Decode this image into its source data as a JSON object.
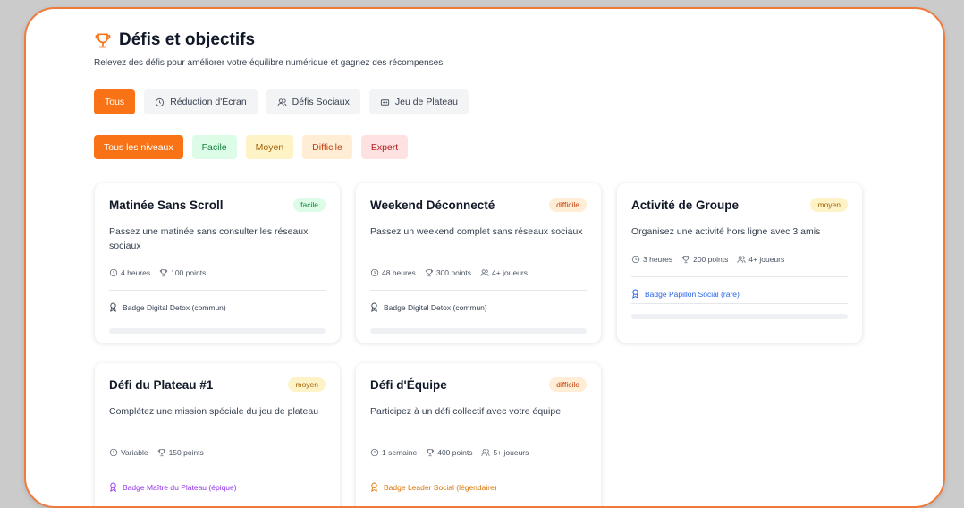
{
  "header": {
    "title": "Défis et objectifs",
    "subtitle": "Relevez des défis pour améliorer votre équilibre numérique et gagnez des récompenses"
  },
  "tabs": [
    {
      "label": "Tous",
      "icon": "",
      "active": true
    },
    {
      "label": "Réduction d'Écran",
      "icon": "clock-icon",
      "active": false
    },
    {
      "label": "Défis Sociaux",
      "icon": "users-icon",
      "active": false
    },
    {
      "label": "Jeu de Plateau",
      "icon": "board-icon",
      "active": false
    }
  ],
  "levels": [
    {
      "label": "Tous les niveaux",
      "bg": "#f97316",
      "fg": "#ffffff"
    },
    {
      "label": "Facile",
      "bg": "#dcfce7",
      "fg": "#15803d"
    },
    {
      "label": "Moyen",
      "bg": "#fef3c7",
      "fg": "#a16207"
    },
    {
      "label": "Difficile",
      "bg": "#ffedd5",
      "fg": "#c2410c"
    },
    {
      "label": "Expert",
      "bg": "#fee2e2",
      "fg": "#b91c1c"
    }
  ],
  "cards": [
    {
      "title": "Matinée Sans Scroll",
      "level": "facile",
      "level_bg": "#dcfce7",
      "level_fg": "#15803d",
      "description": "Passez une matinée sans consulter les réseaux sociaux",
      "duration": "4 heures",
      "points": "100 points",
      "players": "",
      "reward": "Badge Digital Detox (commun)",
      "reward_color": "#374151"
    },
    {
      "title": "Weekend Déconnecté",
      "level": "difficile",
      "level_bg": "#ffedd5",
      "level_fg": "#c2410c",
      "description": "Passez un weekend complet sans réseaux sociaux",
      "duration": "48 heures",
      "points": "300 points",
      "players": "4+ joueurs",
      "reward": "Badge Digital Detox (commun)",
      "reward_color": "#374151"
    },
    {
      "title": "Activité de Groupe",
      "level": "moyen",
      "level_bg": "#fef3c7",
      "level_fg": "#a16207",
      "description": "Organisez une activité hors ligne avec 3 amis",
      "duration": "3 heures",
      "points": "200 points",
      "players": "4+ joueurs",
      "reward": "Badge Papillon Social (rare)",
      "reward_color": "#2563eb"
    },
    {
      "title": "Défi du Plateau #1",
      "level": "moyen",
      "level_bg": "#fef3c7",
      "level_fg": "#a16207",
      "description": "Complétez une mission spéciale du jeu de plateau",
      "duration": "Variable",
      "points": "150 points",
      "players": "",
      "reward": "Badge Maître du Plateau (épique)",
      "reward_color": "#9333ea"
    },
    {
      "title": "Défi d'Équipe",
      "level": "difficile",
      "level_bg": "#ffedd5",
      "level_fg": "#c2410c",
      "description": "Participez à un défi collectif avec votre équipe",
      "duration": "1 semaine",
      "points": "400 points",
      "players": "5+ joueurs",
      "reward": "Badge Leader Social (légendaire)",
      "reward_color": "#d97706"
    }
  ]
}
